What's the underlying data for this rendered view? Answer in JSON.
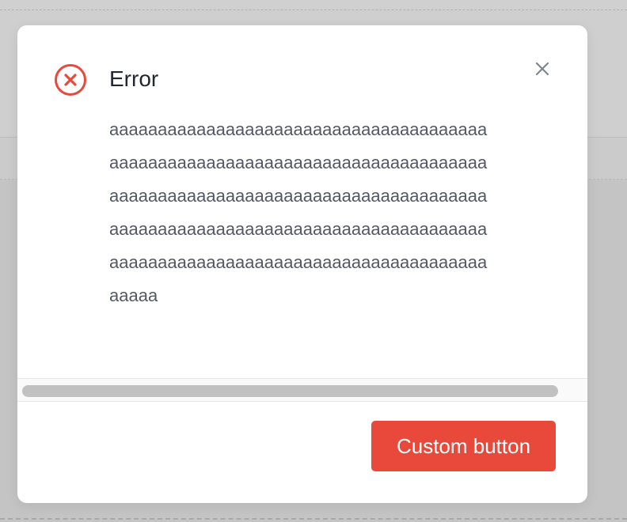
{
  "colors": {
    "accent": "#e9493a",
    "title": "#22262e",
    "message": "#535863",
    "overlay": "#c4c4c4"
  },
  "dialog": {
    "icon": "error-circle-x-icon",
    "title": "Error",
    "message": "aaaaaaaaaaaaaaaaaaaaaaaaaaaaaaaaaaaaaaaaaaaaaaaaaaaaaaaaaaaaaaaaaaaaaaaaaaaaaaaaaaaaaaaaaaaaaaaaaaaaaaaaaaaaaaaaaaaaaaaaaaaaaaaaaaaaaaaaaaaaaaaaaaaaaaaaaaaaaaaaaaaaaaaaaaaaaaaaaaaaaaaaaaaaaaaaaaaaaaaa",
    "close_icon": "close-icon",
    "button_label": "Custom button"
  }
}
